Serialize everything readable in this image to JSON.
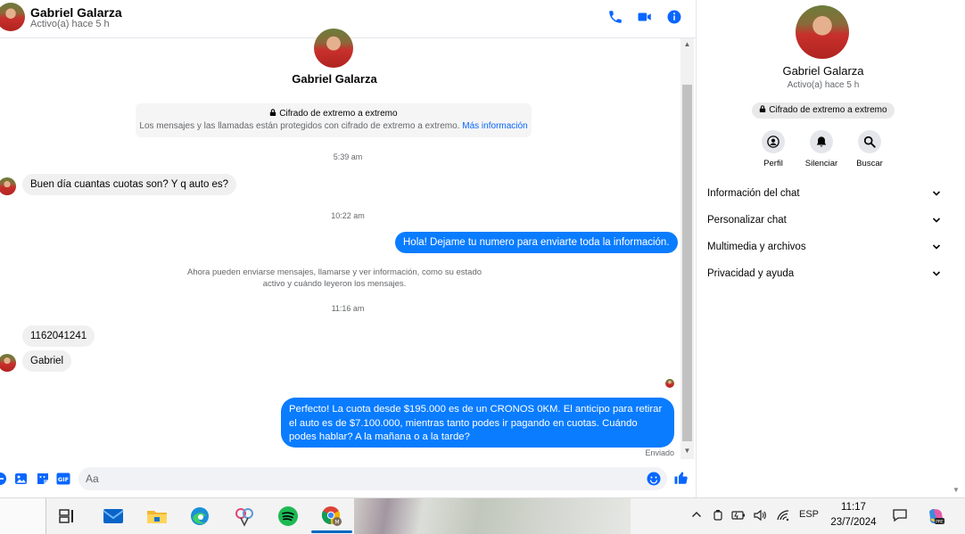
{
  "header": {
    "name": "Gabriel Galarza",
    "status": "Activo(a) hace 5 h"
  },
  "conversation": {
    "top_name": "Gabriel Galarza",
    "e2e_title": "Cifrado de extremo a extremo",
    "e2e_desc": "Los mensajes y las llamadas están protegidos con cifrado de extremo a extremo.",
    "e2e_link": "Más información",
    "time_1": "5:39 am",
    "msg_1": "Buen día cuantas cuotas son? Y q auto es?",
    "time_2": "10:22 am",
    "msg_2": "Hola! Dejame tu numero  para enviarte toda la información.",
    "info_note": "Ahora pueden enviarse mensajes, llamarse y ver información, como su estado activo y cuándo leyeron los mensajes.",
    "time_3": "11:16 am",
    "msg_3": "1162041241",
    "msg_4": "Gabriel",
    "msg_5": "Perfecto! La cuota desde $195.000 es de un CRONOS 0KM. El anticipo para retirar el auto es de $7.100.000, mientras tanto podes ir pagando en cuotas. Cuándo podes hablar? A la mañana o a la tarde?",
    "sent_label": "Enviado"
  },
  "composer": {
    "placeholder": "Aa"
  },
  "right_panel": {
    "name": "Gabriel Galarza",
    "status": "Activo(a) hace 5 h",
    "e2e": "Cifrado de extremo a extremo",
    "actions": {
      "profile": "Perfil",
      "mute": "Silenciar",
      "search": "Buscar"
    },
    "sections": {
      "chat_info": "Información del chat",
      "customize": "Personalizar chat",
      "media": "Multimedia y archivos",
      "privacy": "Privacidad y ayuda"
    }
  },
  "taskbar": {
    "language": "ESP",
    "time": "11:17",
    "date": "23/7/2024"
  },
  "colors": {
    "accent": "#0866ff",
    "bubble_out": "#0a7cff",
    "bubble_in": "#f0f0f0"
  }
}
